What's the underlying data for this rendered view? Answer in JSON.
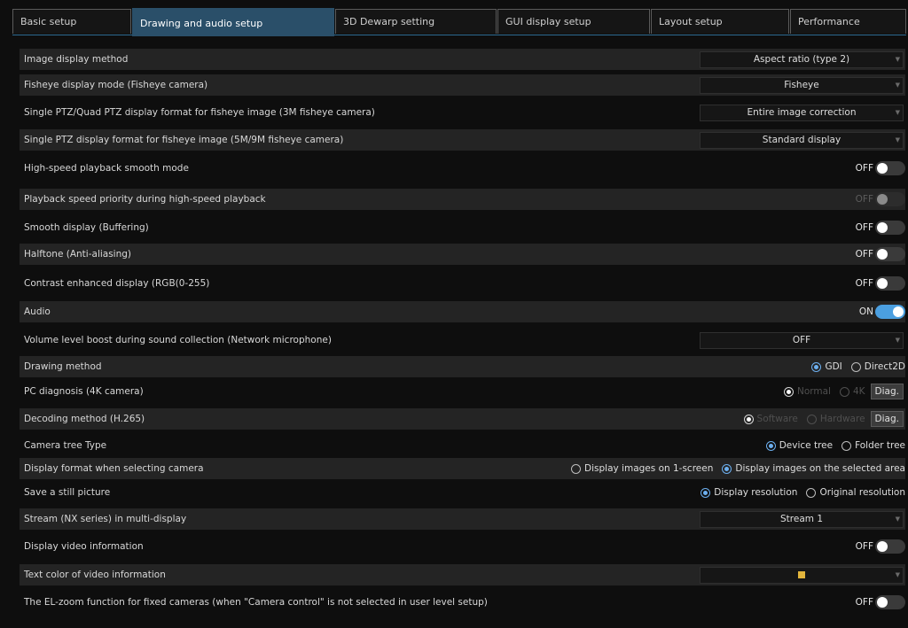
{
  "tabs": [
    {
      "label": "Basic setup"
    },
    {
      "label": "Drawing and audio setup"
    },
    {
      "label": "3D Dewarp setting"
    },
    {
      "label": "GUI display setup"
    },
    {
      "label": "Layout setup"
    },
    {
      "label": "Performance"
    }
  ],
  "active_tab": "Drawing and audio setup",
  "rows": {
    "image_display_method": {
      "label": "Image display method",
      "value": "Aspect ratio (type 2)"
    },
    "fisheye_display_mode": {
      "label": "Fisheye display mode (Fisheye camera)",
      "value": "Fisheye"
    },
    "single_quad_ptz_3m": {
      "label": "Single PTZ/Quad PTZ display format for fisheye image (3M fisheye camera)",
      "value": "Entire image correction"
    },
    "single_ptz_5m9m": {
      "label": "Single PTZ display format for fisheye image (5M/9M fisheye camera)",
      "value": "Standard display"
    },
    "high_speed_smooth": {
      "label": "High-speed playback smooth mode",
      "value": "OFF"
    },
    "playback_speed_priority": {
      "label": "Playback speed priority during high-speed playback",
      "value": "OFF"
    },
    "smooth_display": {
      "label": "Smooth display (Buffering)",
      "value": "OFF"
    },
    "halftone": {
      "label": "Halftone (Anti-aliasing)",
      "value": "OFF"
    },
    "contrast_enhanced": {
      "label": "Contrast enhanced display (RGB(0-255)",
      "value": "OFF"
    },
    "audio": {
      "label": "Audio",
      "value": "ON"
    },
    "volume_boost": {
      "label": "Volume level boost during sound collection (Network microphone)",
      "value": "OFF"
    },
    "drawing_method": {
      "label": "Drawing method",
      "options": [
        "GDI",
        "Direct2D"
      ],
      "selected": "GDI"
    },
    "pc_diagnosis": {
      "label": "PC diagnosis (4K camera)",
      "options": [
        "Normal",
        "4K"
      ],
      "selected": "Normal",
      "button": "Diag."
    },
    "decoding_method": {
      "label": "Decoding method (H.265)",
      "options": [
        "Software",
        "Hardware"
      ],
      "selected": "Software",
      "button": "Diag."
    },
    "camera_tree_type": {
      "label": "Camera tree Type",
      "options": [
        "Device tree",
        "Folder tree"
      ],
      "selected": "Device tree"
    },
    "display_format_selecting": {
      "label": "Display format when selecting camera",
      "options": [
        "Display images on 1-screen",
        "Display images on the selected area"
      ],
      "selected": "Display images on the selected area"
    },
    "save_still_picture": {
      "label": "Save a still picture",
      "options": [
        "Display resolution",
        "Original resolution"
      ],
      "selected": "Display resolution"
    },
    "stream_nx": {
      "label": "Stream (NX series) in multi-display",
      "value": "Stream 1"
    },
    "display_video_info": {
      "label": "Display video information",
      "value": "OFF"
    },
    "text_color_video_info": {
      "label": "Text color of video information",
      "swatch_color": "#e2b53c"
    },
    "el_zoom": {
      "label": "The EL-zoom function for fixed cameras (when \"Camera control\" is not selected in user level setup)",
      "value": "OFF"
    }
  },
  "colors": {
    "accent": "#4b9fe0",
    "active_tab": "#2a4f69",
    "row_alt": "#242424",
    "background": "#0e0e0e"
  }
}
